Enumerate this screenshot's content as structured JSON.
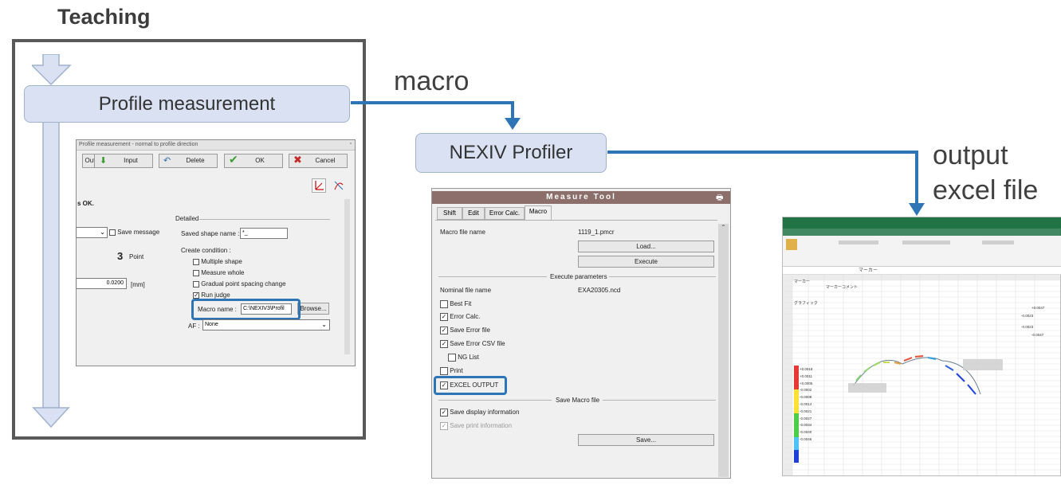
{
  "teaching_title": "Teaching",
  "profile_box": "Profile measurement",
  "macro_label": "macro",
  "nexiv_box": "NEXIV Profiler",
  "output_label_1": "output",
  "output_label_2": "excel file",
  "colors": {
    "flow_fill": "#d9e1f2",
    "connector": "#2e75b6",
    "highlight": "#2e75b6",
    "frame": "#595959"
  },
  "profile_dialog": {
    "title": "Profile measurement - normal to profile direction",
    "out_label": "Out",
    "input_btn": "Input",
    "delete_btn": "Delete",
    "ok_btn": "OK",
    "cancel_btn": "Cancel",
    "status_text": "s OK.",
    "detailed": "Detailed",
    "save_message": "Save message",
    "saved_shape_label": "Saved shape name :",
    "saved_shape_value": "*_",
    "points_value": "3",
    "points_unit": "Point",
    "create_condition": "Create condition :",
    "multiple_shape": "Multiple shape",
    "measure_whole": "Measure whole",
    "gradual": "Gradual point spacing change",
    "run_judge": "Run judge",
    "spacing_value": "0.0200",
    "spacing_unit": "[mm]",
    "macro_name_label": "Macro name :",
    "macro_name_value": "C:\\NEXIV3\\Profil",
    "browse_btn": "Browse...",
    "af_label": "AF :",
    "af_value": "None"
  },
  "measure_tool": {
    "title": "Measure Tool",
    "tabs": [
      "Shift",
      "Edit",
      "Error Calc.",
      "Macro"
    ],
    "macro_file_label": "Macro file name",
    "macro_file_value": "1119_1.pmcr",
    "load_btn": "Load...",
    "execute_btn": "Execute",
    "execute_params": "Execute parameters",
    "nominal_label": "Nominal file name",
    "nominal_value": "EXA20305.ncd",
    "best_fit": "Best Fit",
    "error_calc": "Error Calc.",
    "save_error_file": "Save Error file",
    "save_error_csv": "Save Error CSV file",
    "ng_list": "NG List",
    "print": "Print",
    "excel_output": "EXCEL OUTPUT",
    "save_macro_file": "Save Macro file",
    "save_display_info": "Save display information",
    "save_print_info": "Save print information",
    "save_btn": "Save..."
  },
  "excel": {
    "cell_header": "マーカー",
    "comment_header": "マーカーコメント",
    "graphic_label": "グラフィック",
    "legend_values": [
      "+0.0018",
      "+0.0011",
      "+0.0005",
      "-0.0002",
      "-0.0008",
      "-0.0014",
      "-0.0021",
      "-0.0027",
      "-0.0034",
      "-0.0040",
      "-0.0046"
    ],
    "right_values": [
      "+0.0047",
      "-0.0023",
      "-0.0023",
      "-0.0047"
    ]
  }
}
